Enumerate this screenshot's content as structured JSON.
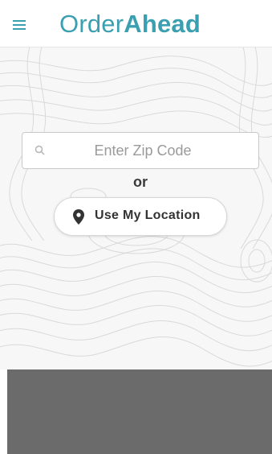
{
  "header": {
    "menu_icon": "hamburger-menu-icon",
    "logo_light": "Order",
    "logo_bold": "Ahead",
    "brand_color": "#3a9fb0"
  },
  "search": {
    "icon": "search-icon",
    "placeholder": "Enter Zip Code",
    "value": ""
  },
  "divider_text": "or",
  "location_button": {
    "icon": "map-pin-icon",
    "label": "Use My Location"
  },
  "colors": {
    "accent": "#3a9fb0",
    "bottom_panel": "#6b6b6b",
    "map_background": "#f7f7f7"
  }
}
